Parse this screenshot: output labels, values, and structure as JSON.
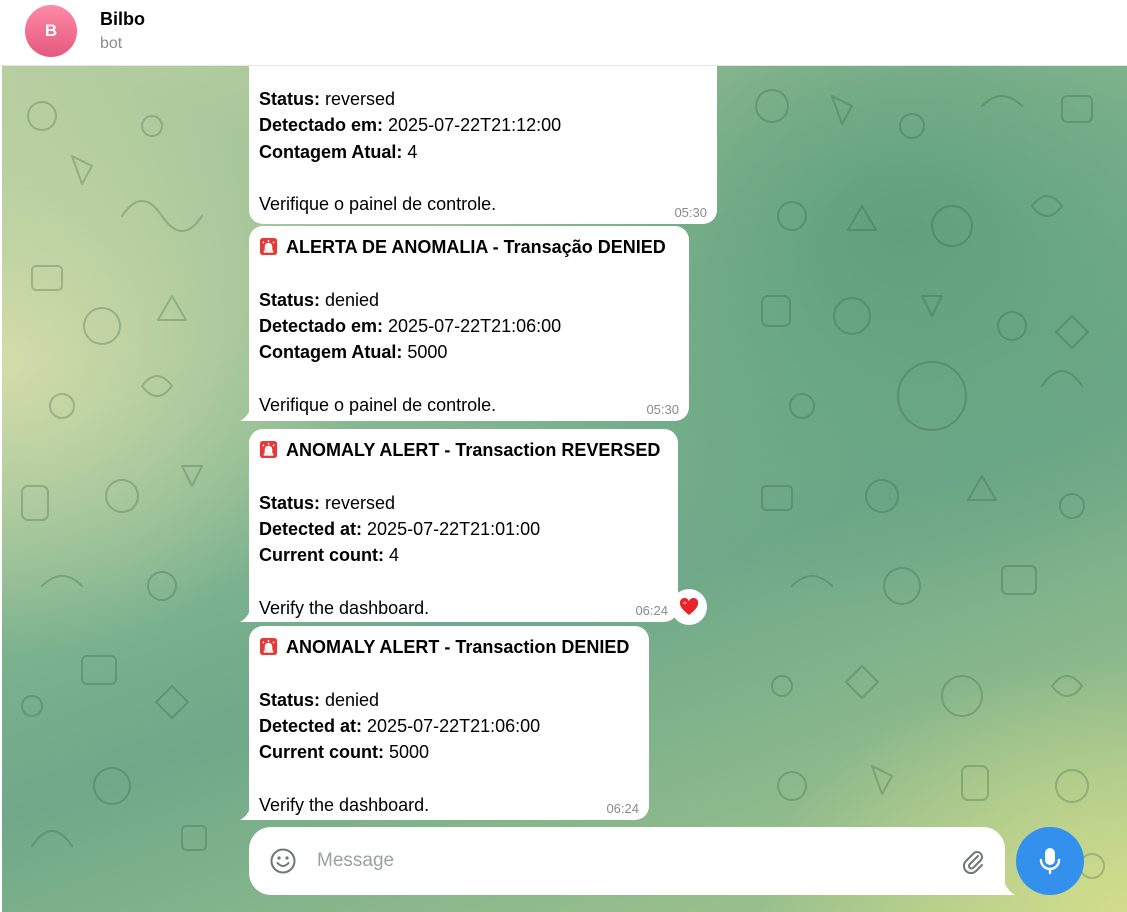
{
  "header": {
    "avatar_initial": "B",
    "chat_name": "Bilbo",
    "chat_status": "bot"
  },
  "messages": [
    {
      "id": "msg1",
      "status_label": "Status:",
      "status_value": " reversed",
      "detected_label": "Detectado em:",
      "detected_value": " 2025-07-22T21:12:00",
      "count_label": "Contagem Atual:",
      "count_value": " 4",
      "footer": "Verifique o painel de controle.",
      "time": "05:30"
    },
    {
      "id": "msg2",
      "title": "ALERTA DE ANOMALIA - Transação DENIED",
      "status_label": "Status:",
      "status_value": " denied",
      "detected_label": "Detectado em:",
      "detected_value": " 2025-07-22T21:06:00",
      "count_label": "Contagem Atual:",
      "count_value": " 5000",
      "footer": "Verifique o painel de controle.",
      "time": "05:30"
    },
    {
      "id": "msg3",
      "title": "ANOMALY ALERT - Transaction REVERSED",
      "status_label": "Status:",
      "status_value": " reversed",
      "detected_label": "Detected at:",
      "detected_value": " 2025-07-22T21:01:00",
      "count_label": "Current count:",
      "count_value": " 4",
      "footer": "Verify the dashboard.",
      "time": "06:24",
      "reaction": "heart-icon"
    },
    {
      "id": "msg4",
      "title": "ANOMALY ALERT - Transaction DENIED",
      "status_label": "Status:",
      "status_value": " denied",
      "detected_label": "Detected at:",
      "detected_value": " 2025-07-22T21:06:00",
      "count_label": "Current count:",
      "count_value": " 5000",
      "footer": "Verify the dashboard.",
      "time": "06:24"
    }
  ],
  "composer": {
    "placeholder": "Message",
    "value": "",
    "emoji_icon": "smile-icon",
    "attach_icon": "paperclip-icon",
    "send_icon": "microphone-icon"
  },
  "colors": {
    "accent": "#3390ec",
    "avatar": "#e5587e",
    "bubble": "#ffffff",
    "time": "#8a8a8a"
  }
}
